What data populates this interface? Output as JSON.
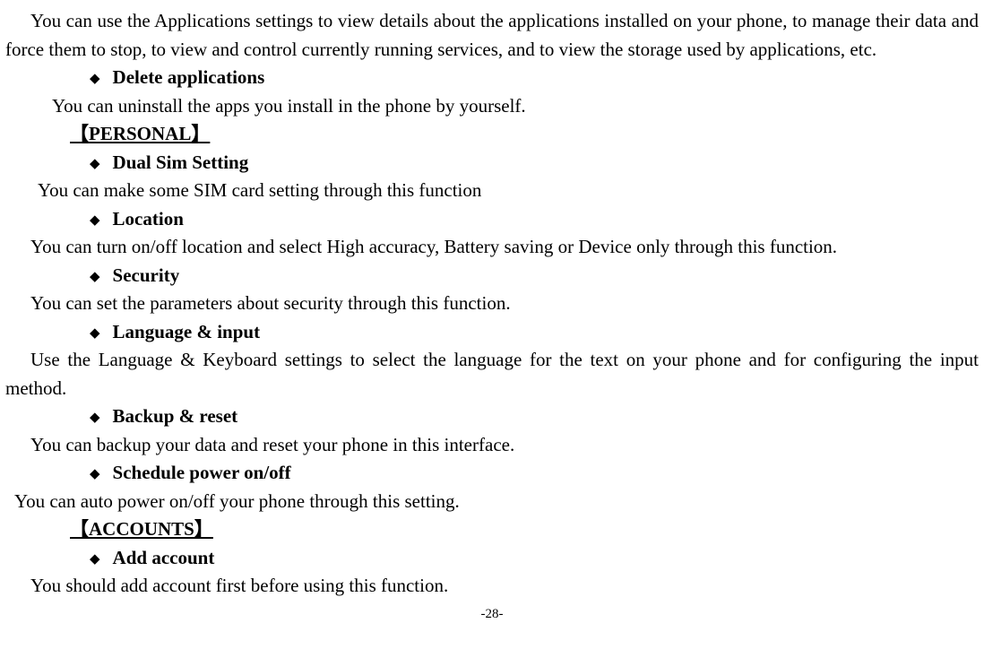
{
  "intro": "You can use the Applications settings to view details about the applications installed on your phone, to manage their data and force them to stop, to view and control currently running services, and to view the storage used by applications, etc.",
  "items": {
    "delete_apps": {
      "title": "Delete applications",
      "desc": "You can uninstall the apps you install in the phone by yourself."
    },
    "dual_sim": {
      "title": "Dual Sim Setting",
      "desc": "You can make some SIM card setting through this function"
    },
    "location": {
      "title": "Location",
      "desc": "You can turn on/off location and select High accuracy, Battery saving or Device only through this function."
    },
    "security": {
      "title": "Security",
      "desc": "You can set the parameters about security through this function."
    },
    "lang_input": {
      "title": "Language & input",
      "desc": "Use the Language & Keyboard settings to select the language for the text on your phone and for configuring the input method."
    },
    "backup": {
      "title": "Backup & reset",
      "desc": "You can backup your data and reset your phone in this interface."
    },
    "schedule": {
      "title": "Schedule power on/off",
      "desc": "You can auto power on/off your phone through this setting."
    },
    "add_account": {
      "title": "Add account",
      "desc": "You should add account first before using this function."
    }
  },
  "sections": {
    "personal": "【PERSONAL】",
    "accounts": "【ACCOUNTS】"
  },
  "page_number": "-28-"
}
